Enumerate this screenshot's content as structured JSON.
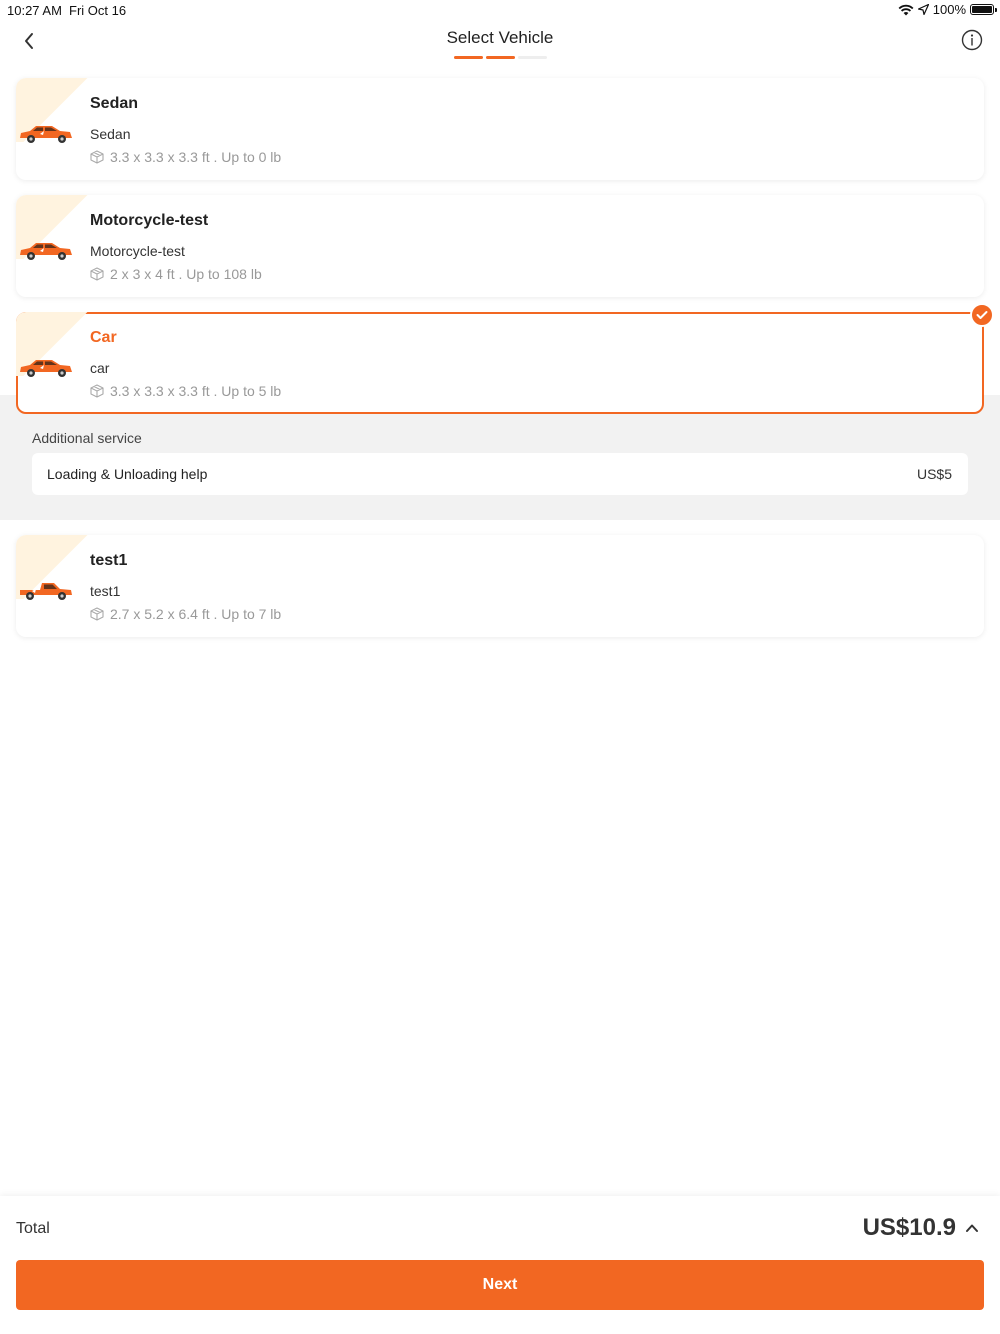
{
  "status_bar": {
    "time": "10:27 AM",
    "date": "Fri Oct 16",
    "battery": "100%"
  },
  "nav": {
    "title": "Select Vehicle",
    "progress_steps": 3,
    "progress_active": 2
  },
  "colors": {
    "accent": "#f26722",
    "corner_tint": "#fff3df",
    "muted_text": "#999999",
    "panel_bg": "#f2f2f2"
  },
  "vehicles": [
    {
      "name": "Sedan",
      "subtitle": "Sedan",
      "spec": "3.3 x 3.3 x 3.3 ft . Up to 0 lb",
      "icon": "car-icon",
      "selected": false
    },
    {
      "name": "Motorcycle-test",
      "subtitle": "Motorcycle-test",
      "spec": "2 x 3 x 4 ft . Up to 108 lb",
      "icon": "car-icon",
      "selected": false
    },
    {
      "name": "Car",
      "subtitle": "car",
      "spec": "3.3 x 3.3 x 3.3 ft . Up to 5 lb",
      "icon": "car-icon",
      "selected": true
    },
    {
      "name": "test1",
      "subtitle": "test1",
      "spec": "2.7 x 5.2 x 6.4 ft . Up to 7 lb",
      "icon": "pickup-truck-icon",
      "selected": false
    }
  ],
  "additional_service": {
    "title": "Additional service",
    "items": [
      {
        "label": "Loading & Unloading help",
        "price": "US$5"
      }
    ]
  },
  "footer": {
    "total_label": "Total",
    "total_value": "US$10.9",
    "next_label": "Next"
  }
}
